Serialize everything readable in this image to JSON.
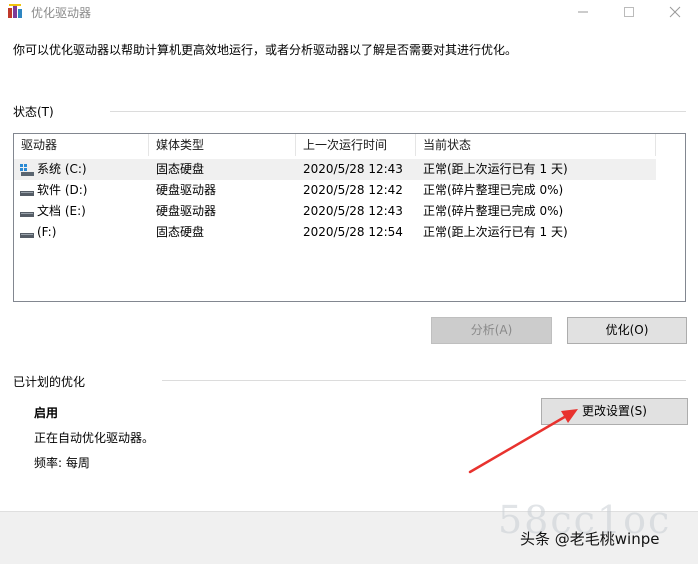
{
  "window": {
    "title": "优化驱动器"
  },
  "intro_text": "你可以优化驱动器以帮助计算机更高效地运行，或者分析驱动器以了解是否需要对其进行优化。",
  "status_section": {
    "label": "状态(T)",
    "columns": [
      "驱动器",
      "媒体类型",
      "上一次运行时间",
      "当前状态"
    ],
    "rows": [
      {
        "drive": "系统 (C:)",
        "media": "固态硬盘",
        "last_run": "2020/5/28 12:43",
        "status": "正常(距上次运行已有 1 天)",
        "icon": "system-drive-icon"
      },
      {
        "drive": "软件 (D:)",
        "media": "硬盘驱动器",
        "last_run": "2020/5/28 12:42",
        "status": "正常(碎片整理已完成 0%)",
        "icon": "hard-drive-icon"
      },
      {
        "drive": "文档 (E:)",
        "media": "硬盘驱动器",
        "last_run": "2020/5/28 12:43",
        "status": "正常(碎片整理已完成 0%)",
        "icon": "hard-drive-icon"
      },
      {
        "drive": "(F:)",
        "media": "固态硬盘",
        "last_run": "2020/5/28 12:54",
        "status": "正常(距上次运行已有 1 天)",
        "icon": "hard-drive-icon"
      }
    ]
  },
  "buttons": {
    "analyze": "分析(A)",
    "optimize": "优化(O)",
    "change_settings": "更改设置(S)"
  },
  "scheduled_section": {
    "label": "已计划的优化",
    "status": "启用",
    "description": "正在自动优化驱动器。",
    "frequency": "频率: 每周"
  },
  "overlay": {
    "watermark": "58cc1oc",
    "attribution": "头条 @老毛桃winpe"
  },
  "colors": {
    "annotation_arrow": "#e8322e",
    "selected_row": "#f0f0f0",
    "footer": "#f0f0f0"
  }
}
